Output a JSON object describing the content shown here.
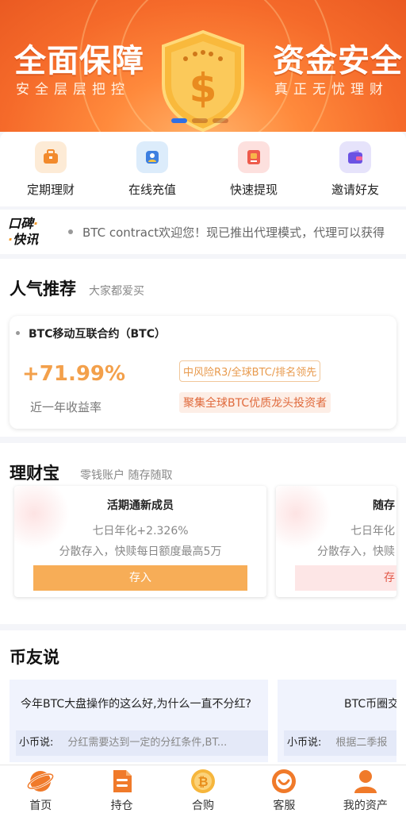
{
  "banner": {
    "left_title": "全面保障",
    "left_sub": "安全层层把控",
    "right_title": "资金安全",
    "right_sub": "真正无忧理财",
    "dots": 3,
    "active_dot": 0
  },
  "quick_nav": [
    {
      "label": "定期理财",
      "icon": "briefcase-icon",
      "bg": "#fdebd6",
      "fg": "#f28a2c"
    },
    {
      "label": "在线充值",
      "icon": "user-badge-icon",
      "bg": "#dcecfb",
      "fg": "#3d7fe0"
    },
    {
      "label": "快速提现",
      "icon": "withdraw-card-icon",
      "bg": "#fde0de",
      "fg": "#ee5b4c"
    },
    {
      "label": "邀请好友",
      "icon": "wallet-icon",
      "bg": "#e6e3fb",
      "fg": "#6b52e3"
    }
  ],
  "ticker": {
    "logo_line1": "口碑",
    "logo_line2": "快讯",
    "text": "BTC contract欢迎您！现已推出代理模式，代理可以获得"
  },
  "popular": {
    "title": "人气推荐",
    "subtitle": "大家都爱买",
    "product_name": "BTC移动互联合约（BTC）",
    "rate": "+71.99%",
    "rate_label": "近一年收益率",
    "tag_risk": "中风险R3/全球BTC/排名领先",
    "tag_desc": "聚集全球BTC优质龙头投资者"
  },
  "licaibao": {
    "title": "理财宝",
    "subtitle": "零钱账户 随存随取",
    "cards": [
      {
        "title": "活期通新成员",
        "rate": "七日年化+2.326%",
        "desc": "分散存入，快赎每日额度最高5万",
        "button": "存入"
      },
      {
        "title": "随存",
        "rate": "七日年化",
        "desc": "分散存入，快赎",
        "button": "存"
      }
    ]
  },
  "biyou": {
    "title": "币友说",
    "posts": [
      {
        "title": "今年BTC大盘操作的这么好,为什么一直不分红?",
        "author": "小币说:",
        "reply": "分红需要达到一定的分红条件,BT..."
      },
      {
        "title": "BTC币圈交",
        "author": "小币说:",
        "reply": "根据二季报"
      }
    ]
  },
  "tabbar": [
    {
      "label": "首页",
      "icon": "home-planet-icon",
      "active": true
    },
    {
      "label": "持仓",
      "icon": "document-icon",
      "active": false
    },
    {
      "label": "合购",
      "icon": "bitcoin-coin-icon",
      "active": false
    },
    {
      "label": "客服",
      "icon": "customer-service-icon",
      "active": false
    },
    {
      "label": "我的资产",
      "icon": "user-icon",
      "active": false
    }
  ],
  "colors": {
    "accent": "#f29b2c",
    "orange_banner": "#f56a2a",
    "rate": "#f3a04b"
  }
}
